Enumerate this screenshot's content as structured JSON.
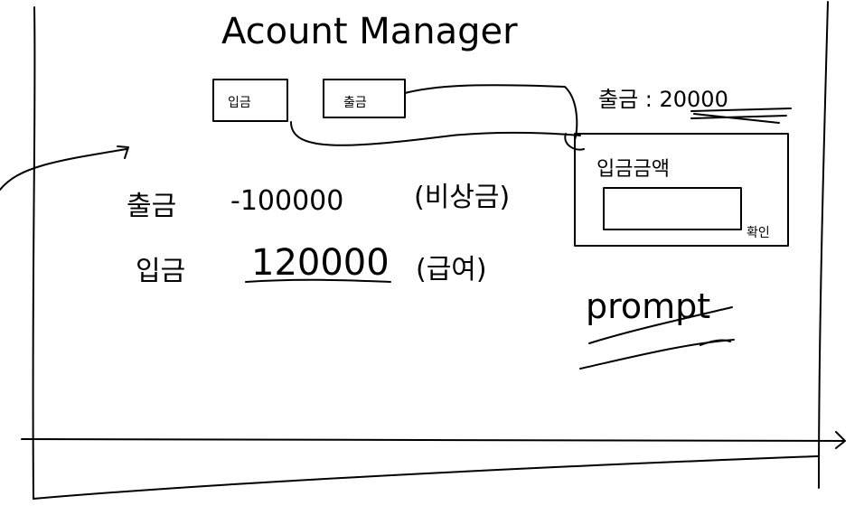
{
  "sketch": {
    "title": "Acount Manager",
    "buttons": [
      {
        "label": "입금"
      },
      {
        "label": "출금"
      }
    ],
    "rows": [
      {
        "label": "출금",
        "amount": "-100000",
        "note": "(비상금)"
      },
      {
        "label": "입금",
        "amount": "120000",
        "note": "(급여)"
      }
    ],
    "popup": {
      "title": "출금 : 20000",
      "prompt": "입금금액",
      "confirm_label": "확인"
    },
    "word": "prompt"
  }
}
